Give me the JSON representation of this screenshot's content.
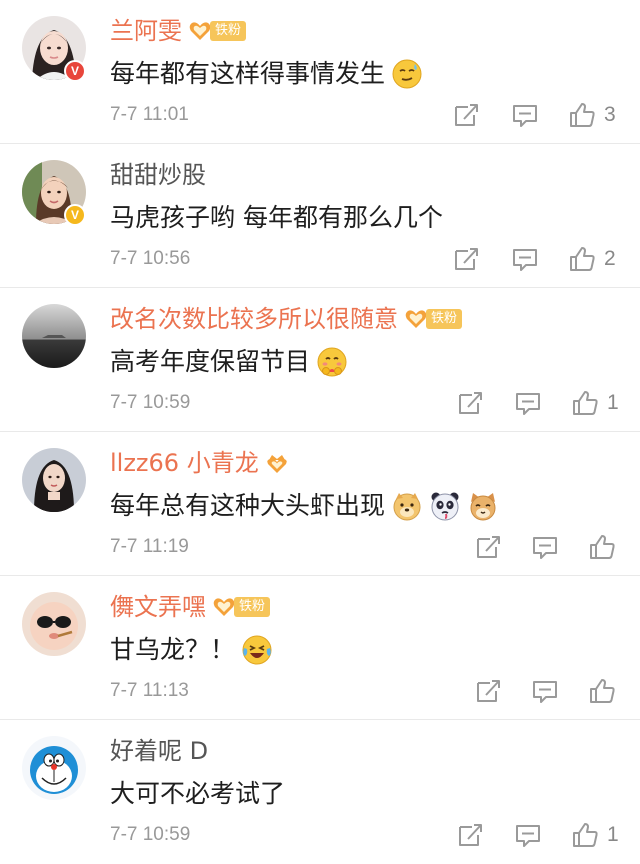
{
  "colors": {
    "name_orange": "#eb7350",
    "name_grey": "#555555",
    "time_grey": "#999999",
    "icon_grey": "#9a9a9a",
    "fan_badge": "#f6c55a",
    "verified_red": "#e8463b",
    "verified_gold": "#f5b81d"
  },
  "comments": [
    {
      "name": "兰阿雯",
      "name_style": "orange",
      "fan_badge": "铁粉",
      "verified": "red",
      "verified_mark": "V",
      "text": "每年都有这样得事情发生",
      "emojis": [
        "sweat-smile-emoji"
      ],
      "time": "7-7 11:01",
      "likes": "3"
    },
    {
      "name": "甜甜炒股",
      "name_style": "grey",
      "fan_badge": "",
      "verified": "gold",
      "verified_mark": "V",
      "text": "马虎孩子哟  每年都有那么几个",
      "emojis": [],
      "time": "7-7 10:56",
      "likes": "2"
    },
    {
      "name": "改名次数比较多所以很随意",
      "name_style": "orange",
      "fan_badge": "铁粉",
      "verified": "",
      "text": "高考年度保留节目",
      "emojis": [
        "hug-emoji"
      ],
      "time": "7-7 10:59",
      "likes": "1"
    },
    {
      "name": "llzz66 小青龙",
      "name_style": "orange",
      "fan_badge": "",
      "verified": "",
      "text": "每年总有这种大头虾出现",
      "emojis": [
        "doge-emoji",
        "panda-emoji",
        "cat-emoji"
      ],
      "time": "7-7 11:19",
      "likes": ""
    },
    {
      "name": "儛文弄嘿",
      "name_style": "orange",
      "fan_badge": "铁粉",
      "verified": "",
      "text": "甘乌龙？！",
      "emojis": [
        "laugh-cry-emoji"
      ],
      "time": "7-7 11:13",
      "likes": ""
    },
    {
      "name": "好着呢 D",
      "name_style": "grey",
      "fan_badge": "",
      "verified": "",
      "text": "大可不必考试了",
      "emojis": [],
      "time": "7-7 10:59",
      "likes": "1"
    }
  ]
}
